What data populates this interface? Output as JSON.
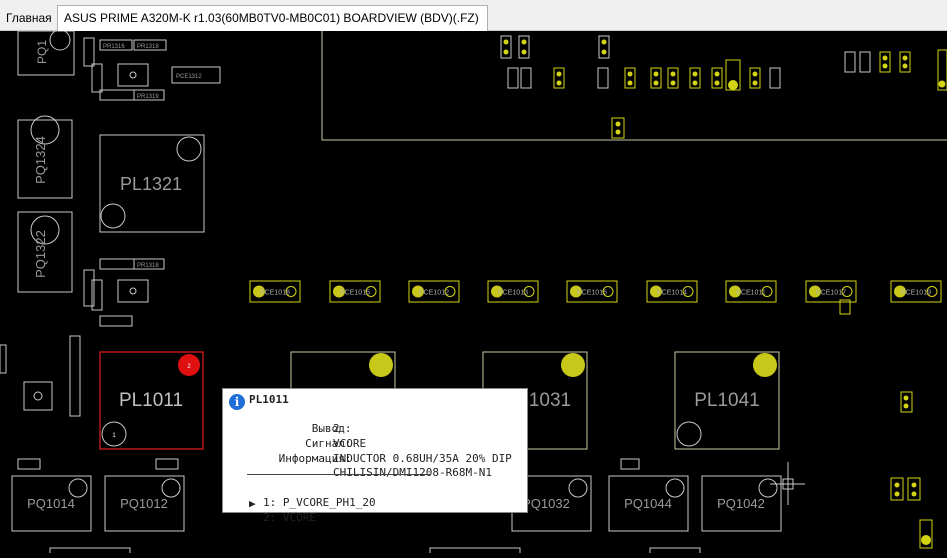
{
  "tabs": [
    {
      "label": "Главная"
    },
    {
      "label": "ASUS PRIME A320M-K r1.03(60MB0TV0-MB0C01) BOARDVIEW (BDV)(.FZ)"
    }
  ],
  "board": {
    "large_parts": {
      "pl1321": "PL1321",
      "pl1011": "PL1011",
      "pl1031": "1031",
      "pl1041": "PL1041",
      "pq1324": "PQ1324",
      "pq1322": "PQ1322",
      "pq1014": "PQ1014",
      "pq1012": "PQ1012",
      "pq1032": "PQ1032",
      "pq1044": "PQ1044",
      "pq1042": "PQ1042",
      "pq1_top": "PQ1"
    },
    "caps_row": [
      "PCE1018",
      "PCE1015",
      "PCE1012",
      "PCE1013",
      "PCE1016",
      "PCE1014",
      "PCE1011",
      "PCE1017",
      "PCE1019"
    ],
    "small_parts": [
      "PR1316",
      "PR1318",
      "PCE1312",
      "PR1319",
      "PR1318"
    ],
    "pin_labels": {
      "pl1011_pin1": "1",
      "pl1011_pin2": "2"
    },
    "colors": {
      "outline": "#c8c8c8",
      "pad": "#d4d415",
      "pad_outline": "#c8c800",
      "selected": "#d81b1b",
      "background": "#000000"
    }
  },
  "tooltip": {
    "icon": "info-icon",
    "title": "PL1011",
    "rows": [
      {
        "key": "Вывод:",
        "value": "2"
      },
      {
        "key": "Сигнал:",
        "value": "VCORE"
      },
      {
        "key": "Информация:",
        "value": "INDUCTOR 0.68UH/35A 20% DIP"
      },
      {
        "key": "",
        "value": "CHILISIN/DMI1208-R68M-N1"
      }
    ],
    "pins": [
      {
        "marker": "",
        "label": "1: P_VCORE_PH1_20"
      },
      {
        "marker": "▶",
        "label": "2: VCORE"
      }
    ]
  }
}
